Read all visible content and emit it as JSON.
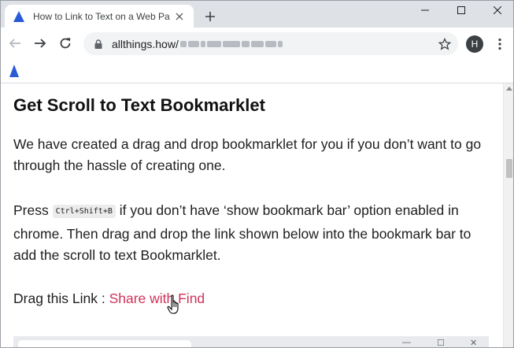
{
  "browser": {
    "tab": {
      "title": "How to Link to Text on a Web Pa",
      "favicon": "allthings-how-logo-icon",
      "close_icon": "close-icon"
    },
    "new_tab_icon": "plus-icon",
    "window_controls": [
      "minimize-icon",
      "maximize-icon",
      "close-icon"
    ],
    "nav_icons": [
      "back-arrow-icon",
      "forward-arrow-icon",
      "reload-icon"
    ],
    "address": {
      "secure_icon": "lock-icon",
      "url_visible": "allthings.how/",
      "star_icon": "star-icon"
    },
    "profile": {
      "initial": "H"
    },
    "menu_icon": "kebab-menu-icon",
    "bookmark_icon": "allthings-how-logo-icon",
    "accent_color": "#2a5bd7"
  },
  "article": {
    "heading": "Get Scroll to Text Bookmarklet",
    "paragraph1": "We have created a drag and drop bookmarklet for you if you don’t want to go through the hassle of creating one.",
    "paragraph2": {
      "before": "Press ",
      "shortcut": "Ctrl+Shift+B",
      "after": " if you don’t have ‘show bookmark bar’ option enabled in chrome. Then drag and drop the link shown below into the bookmark bar to add the scroll to text Bookmarklet."
    },
    "drag_line": {
      "label": "Drag this Link : ",
      "link_text": "Share with Find",
      "link_color": "#d0325a"
    },
    "cursor_icon": "hand-pointer-icon"
  }
}
